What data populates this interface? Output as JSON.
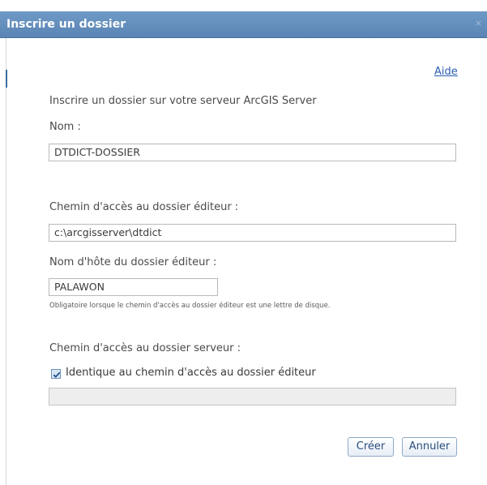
{
  "dialog": {
    "title": "Inscrire un dossier",
    "close_glyph": "×",
    "help_link": "Aide"
  },
  "form": {
    "intro": "Inscrire un dossier sur votre serveur ArcGIS Server",
    "name_label": "Nom :",
    "name_value": "DTDICT-DOSSIER",
    "publisher_path_label": "Chemin d'accès au dossier éditeur :",
    "publisher_path_value": "c:\\arcgisserver\\dtdict",
    "publisher_host_label": "Nom d'hôte du dossier éditeur :",
    "publisher_host_value": "PALAWON",
    "publisher_host_note": "Obligatoire lorsque le chemin d'accès au dossier éditeur est une lettre de disque.",
    "server_path_label": "Chemin d'accès au dossier serveur :",
    "same_as_publisher_label": "Identique au chemin d'accès au dossier éditeur",
    "same_as_publisher_checked": true,
    "server_path_value": ""
  },
  "buttons": {
    "create": "Créer",
    "cancel": "Annuler"
  },
  "colors": {
    "titlebar": "#5f8aba",
    "link": "#2a5db0",
    "button_text": "#2a4f7e"
  },
  "icons": {
    "close": "close-icon",
    "checkbox": "checkmark-icon"
  }
}
